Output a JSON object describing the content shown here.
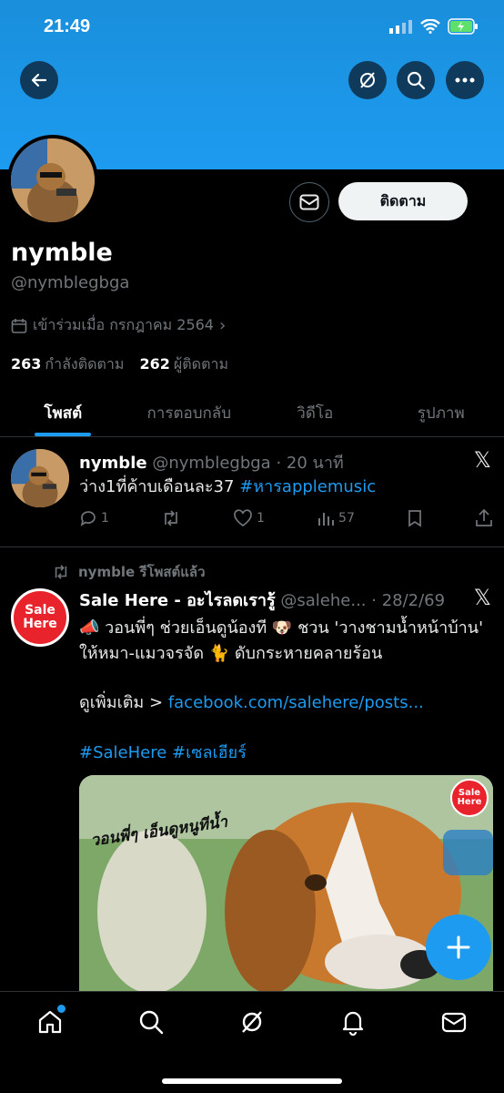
{
  "status_bar": {
    "time": "21:49"
  },
  "profile": {
    "follow_label": "ติดตาม",
    "name": "nymble",
    "handle": "@nymblegbga",
    "joined": "เข้าร่วมเมื่อ กรกฎาคม 2564",
    "following_count": "263",
    "following_label": "กำลังติดตาม",
    "followers_count": "262",
    "followers_label": "ผู้ติดตาม"
  },
  "tabs": [
    {
      "label": "โพสต์"
    },
    {
      "label": "การตอบกลับ"
    },
    {
      "label": "วิดีโอ"
    },
    {
      "label": "รูปภาพ"
    }
  ],
  "post1": {
    "name": "nymble",
    "handle": "@nymblegbga",
    "time": "· 20 นาที",
    "text": "ว่าง1ที่ค้าบเดือนละ37 ",
    "hashtag": "#หารapplemusic",
    "replies": "1",
    "likes": "1",
    "views": "57"
  },
  "post2": {
    "reposted_by": "nymble รีโพสต์แล้ว",
    "name": "Sale Here - อะไรลดเรารู้",
    "handle": "@salehe...",
    "time": "· 28/2/69",
    "avatar_text": "Sale Here",
    "text": "📣 วอนพี่ๆ ช่วยเอ็นดูน้องที 🐶 ชวน 'วางชามน้ำหน้าบ้าน' ให้หมา-แมวจรจัด 🐈 ดับกระหายคลายร้อน",
    "more_prefix": "ดูเพิ่มเติม > ",
    "more_link": "facebook.com/salehere/posts...",
    "hashtags": "#SaleHere #เซลเฮียร์",
    "image_caption": "วอนพี่ๆ เอ็นดูหนูทีน้ำ",
    "image_logo": "Sale Here"
  },
  "colors": {
    "accent": "#1d9bf0",
    "banner": "#1d9bf0"
  }
}
